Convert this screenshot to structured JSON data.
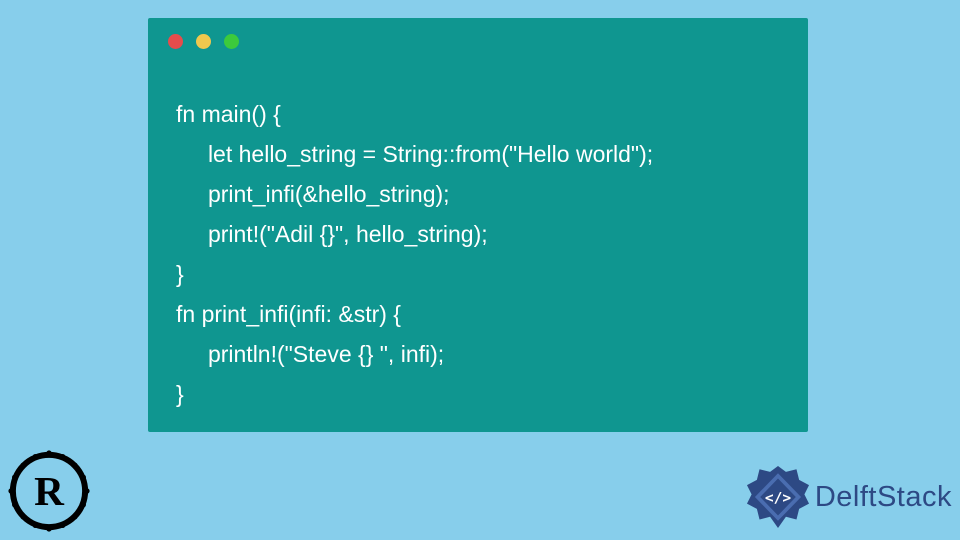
{
  "window": {
    "dots": [
      "red",
      "yellow",
      "green"
    ]
  },
  "code": {
    "lines": [
      "fn main() {",
      "     let hello_string = String::from(\"Hello world\");",
      "     print_infi(&hello_string);",
      "     print!(\"Adil {}\", hello_string);",
      "}",
      "fn print_infi(infi: &str) {",
      "     println!(\"Steve {} \", infi);",
      "}"
    ]
  },
  "logos": {
    "language_icon": "rust-logo",
    "brand_icon": "delftstack-emblem",
    "brand_text": "DelftStack"
  },
  "colors": {
    "page_bg": "#87ceeb",
    "code_bg": "#0f9690",
    "code_fg": "#ffffff",
    "brand_color": "#2d4984"
  }
}
